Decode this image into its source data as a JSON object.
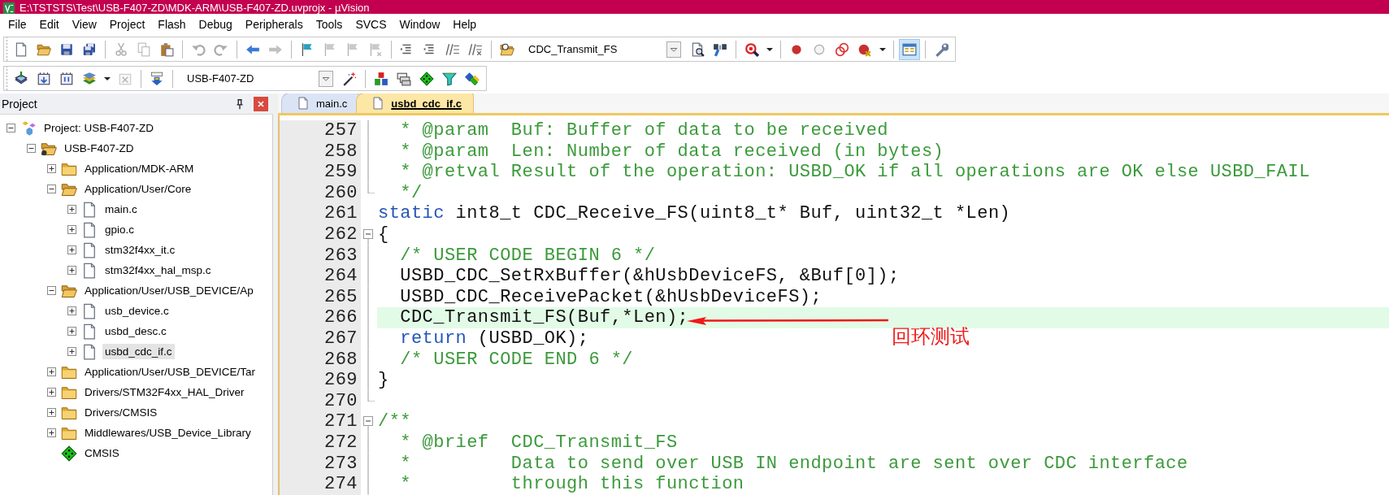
{
  "window": {
    "title": "E:\\TSTSTS\\Test\\USB-F407-ZD\\MDK-ARM\\USB-F407-ZD.uvprojx - µVision"
  },
  "menu": [
    "File",
    "Edit",
    "View",
    "Project",
    "Flash",
    "Debug",
    "Peripherals",
    "Tools",
    "SVCS",
    "Window",
    "Help"
  ],
  "toolbars": [
    {
      "items": [
        {
          "kind": "new",
          "disabled": false,
          "pressed": false
        },
        {
          "kind": "open",
          "disabled": false,
          "pressed": false
        },
        {
          "kind": "save",
          "disabled": false,
          "pressed": false
        },
        {
          "kind": "save-all",
          "disabled": false,
          "pressed": false
        },
        {
          "kind": "separator"
        },
        {
          "kind": "cut",
          "disabled": true,
          "pressed": false
        },
        {
          "kind": "copy",
          "disabled": true,
          "pressed": false
        },
        {
          "kind": "paste",
          "disabled": false,
          "pressed": false
        },
        {
          "kind": "separator"
        },
        {
          "kind": "undo",
          "disabled": true,
          "pressed": false
        },
        {
          "kind": "redo",
          "disabled": true,
          "pressed": false
        },
        {
          "kind": "separator"
        },
        {
          "kind": "back",
          "disabled": false,
          "pressed": false
        },
        {
          "kind": "forward",
          "disabled": true,
          "pressed": false
        },
        {
          "kind": "separator"
        },
        {
          "kind": "bookmark",
          "disabled": false,
          "pressed": false
        },
        {
          "kind": "bookmark-prev",
          "disabled": true,
          "pressed": false
        },
        {
          "kind": "bookmark-next",
          "disabled": true,
          "pressed": false
        },
        {
          "kind": "bookmark-clear",
          "disabled": true,
          "pressed": false
        },
        {
          "kind": "separator"
        },
        {
          "kind": "indent",
          "disabled": false,
          "pressed": false
        },
        {
          "kind": "unindent",
          "disabled": false,
          "pressed": false
        },
        {
          "kind": "comment",
          "disabled": false,
          "pressed": false
        },
        {
          "kind": "uncomment",
          "disabled": false,
          "pressed": false
        },
        {
          "kind": "separator"
        },
        {
          "kind": "find-files",
          "disabled": false,
          "pressed": false
        },
        {
          "kind": "function-combo",
          "value": "CDC_Transmit_FS"
        },
        {
          "kind": "find",
          "disabled": false,
          "pressed": false
        },
        {
          "kind": "incremental-find",
          "disabled": false,
          "pressed": false
        },
        {
          "kind": "separator"
        },
        {
          "kind": "debug",
          "disabled": false,
          "pressed": false
        },
        {
          "kind": "caret",
          "disabled": false,
          "pressed": false
        },
        {
          "kind": "separator"
        },
        {
          "kind": "breakpoint",
          "disabled": false,
          "pressed": false
        },
        {
          "kind": "breakpoint-enable",
          "disabled": false,
          "pressed": false
        },
        {
          "kind": "breakpoint-disable-all",
          "disabled": false,
          "pressed": false
        },
        {
          "kind": "breakpoint-kill",
          "disabled": false,
          "pressed": false
        },
        {
          "kind": "caret",
          "disabled": false,
          "pressed": false
        },
        {
          "kind": "separator"
        },
        {
          "kind": "window-layout",
          "disabled": false,
          "pressed": true
        },
        {
          "kind": "separator"
        },
        {
          "kind": "configure",
          "disabled": false,
          "pressed": false
        }
      ]
    },
    {
      "items": [
        {
          "kind": "translate",
          "disabled": false,
          "pressed": false
        },
        {
          "kind": "build",
          "disabled": false,
          "pressed": false
        },
        {
          "kind": "rebuild",
          "disabled": false,
          "pressed": false
        },
        {
          "kind": "batch-build",
          "disabled": false,
          "pressed": false
        },
        {
          "kind": "caret",
          "disabled": false,
          "pressed": false
        },
        {
          "kind": "stop-build",
          "disabled": true,
          "pressed": false
        },
        {
          "kind": "separator"
        },
        {
          "kind": "download",
          "disabled": false,
          "pressed": false
        },
        {
          "kind": "separator"
        },
        {
          "kind": "target-combo",
          "value": "USB-F407-ZD"
        },
        {
          "kind": "options",
          "disabled": false,
          "pressed": false
        },
        {
          "kind": "separator"
        },
        {
          "kind": "manage-components",
          "disabled": false,
          "pressed": false
        },
        {
          "kind": "books",
          "disabled": false,
          "pressed": false
        },
        {
          "kind": "select-packs",
          "disabled": false,
          "pressed": false
        },
        {
          "kind": "filter",
          "disabled": false,
          "pressed": false
        },
        {
          "kind": "pack-installer",
          "disabled": false,
          "pressed": false
        }
      ]
    }
  ],
  "project_panel": {
    "title": "Project",
    "tree": [
      {
        "kind": "project",
        "label": "Project: USB-F407-ZD",
        "expanded": true,
        "selected": false,
        "children": [
          {
            "kind": "target",
            "label": "USB-F407-ZD",
            "expanded": true,
            "selected": false,
            "children": [
              {
                "kind": "folder",
                "label": "Application/MDK-ARM",
                "expanded": false,
                "selected": false
              },
              {
                "kind": "folder",
                "label": "Application/User/Core",
                "expanded": true,
                "selected": false,
                "children": [
                  {
                    "kind": "file",
                    "label": "main.c",
                    "expanded": false,
                    "selected": false
                  },
                  {
                    "kind": "file",
                    "label": "gpio.c",
                    "expanded": false,
                    "selected": false
                  },
                  {
                    "kind": "file",
                    "label": "stm32f4xx_it.c",
                    "expanded": false,
                    "selected": false
                  },
                  {
                    "kind": "file",
                    "label": "stm32f4xx_hal_msp.c",
                    "expanded": false,
                    "selected": false
                  }
                ]
              },
              {
                "kind": "folder",
                "label": "Application/User/USB_DEVICE/Ap",
                "expanded": true,
                "selected": false,
                "children": [
                  {
                    "kind": "file",
                    "label": "usb_device.c",
                    "expanded": false,
                    "selected": false
                  },
                  {
                    "kind": "file",
                    "label": "usbd_desc.c",
                    "expanded": false,
                    "selected": false
                  },
                  {
                    "kind": "file",
                    "label": "usbd_cdc_if.c",
                    "expanded": false,
                    "selected": true
                  }
                ]
              },
              {
                "kind": "folder",
                "label": "Application/User/USB_DEVICE/Tar",
                "expanded": false,
                "selected": false
              },
              {
                "kind": "folder",
                "label": "Drivers/STM32F4xx_HAL_Driver",
                "expanded": false,
                "selected": false
              },
              {
                "kind": "folder",
                "label": "Drivers/CMSIS",
                "expanded": false,
                "selected": false
              },
              {
                "kind": "folder",
                "label": "Middlewares/USB_Device_Library",
                "expanded": false,
                "selected": false
              },
              {
                "kind": "component",
                "label": "CMSIS",
                "selected": false
              }
            ]
          }
        ]
      }
    ]
  },
  "editor": {
    "tabs": [
      {
        "label": "main.c",
        "selected": false
      },
      {
        "label": "usbd_cdc_if.c",
        "selected": true
      }
    ],
    "lines": [
      {
        "number": "257",
        "kind": "fold-body",
        "current": false,
        "tokens": [
          {
            "kind": "comment",
            "text": "  * @param  Buf: Buffer of data to be received"
          }
        ]
      },
      {
        "number": "258",
        "kind": "fold-body",
        "current": false,
        "tokens": [
          {
            "kind": "comment",
            "text": "  * @param  Len: Number of data received (in bytes)"
          }
        ]
      },
      {
        "number": "259",
        "kind": "fold-body",
        "current": false,
        "tokens": [
          {
            "kind": "comment",
            "text": "  * @retval Result of the operation: USBD_OK if all operations are OK else USBD_FAIL"
          }
        ]
      },
      {
        "number": "260",
        "kind": "fold-end",
        "current": false,
        "tokens": [
          {
            "kind": "comment",
            "text": "  */"
          }
        ]
      },
      {
        "number": "261",
        "kind": "plain",
        "current": false,
        "tokens": [
          {
            "kind": "keyword",
            "text": "static"
          },
          {
            "kind": "plain",
            "text": " int8_t CDC_Receive_FS(uint8_t* Buf, uint32_t *Len)"
          }
        ]
      },
      {
        "number": "262",
        "kind": "fold-start",
        "current": false,
        "tokens": [
          {
            "kind": "plain",
            "text": "{"
          }
        ]
      },
      {
        "number": "263",
        "kind": "fold-body",
        "current": false,
        "tokens": [
          {
            "kind": "comment",
            "text": "  /* USER CODE BEGIN 6 */"
          }
        ]
      },
      {
        "number": "264",
        "kind": "fold-body",
        "current": false,
        "tokens": [
          {
            "kind": "plain",
            "text": "  USBD_CDC_SetRxBuffer(&hUsbDeviceFS, &Buf[0]);"
          }
        ]
      },
      {
        "number": "265",
        "kind": "fold-body",
        "current": false,
        "tokens": [
          {
            "kind": "plain",
            "text": "  USBD_CDC_ReceivePacket(&hUsbDeviceFS);"
          }
        ]
      },
      {
        "number": "266",
        "kind": "fold-body",
        "current": true,
        "tokens": [
          {
            "kind": "plain",
            "text": "  CDC_Transmit_FS(Buf,*Len);"
          }
        ]
      },
      {
        "number": "267",
        "kind": "fold-body",
        "current": false,
        "tokens": [
          {
            "kind": "keyword",
            "text": "  return"
          },
          {
            "kind": "plain",
            "text": " (USBD_OK);"
          }
        ]
      },
      {
        "number": "268",
        "kind": "fold-body",
        "current": false,
        "tokens": [
          {
            "kind": "comment",
            "text": "  /* USER CODE END 6 */"
          }
        ]
      },
      {
        "number": "269",
        "kind": "fold-body",
        "current": false,
        "tokens": [
          {
            "kind": "plain",
            "text": "}"
          }
        ]
      },
      {
        "number": "270",
        "kind": "fold-end",
        "current": false
      },
      {
        "number": "271",
        "kind": "fold-start",
        "current": false,
        "tokens": [
          {
            "kind": "comment",
            "text": "/**"
          }
        ]
      },
      {
        "number": "272",
        "kind": "fold-body",
        "current": false,
        "tokens": [
          {
            "kind": "comment",
            "text": "  * @brief  CDC_Transmit_FS"
          }
        ]
      },
      {
        "number": "273",
        "kind": "fold-body",
        "current": false,
        "tokens": [
          {
            "kind": "comment",
            "text": "  *         Data to send over USB IN endpoint are sent over CDC interface"
          }
        ]
      },
      {
        "number": "274",
        "kind": "fold-body",
        "current": false,
        "tokens": [
          {
            "kind": "comment",
            "text": "  *         through this function"
          }
        ]
      }
    ],
    "annotation": {
      "text": "回环测试"
    }
  }
}
